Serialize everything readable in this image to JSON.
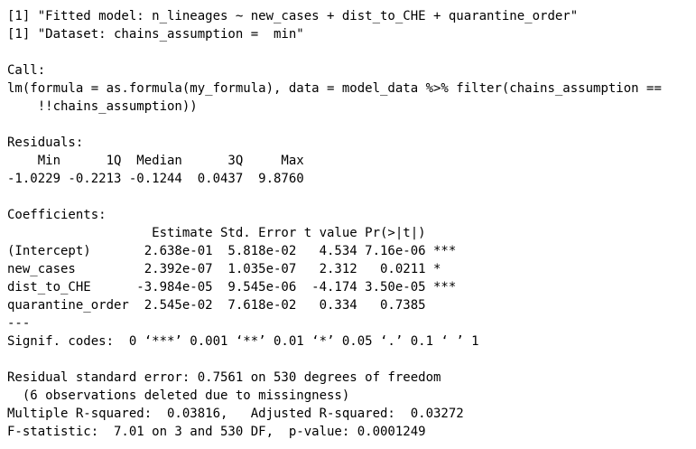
{
  "console": {
    "lines": [
      "[1] \"Fitted model: n_lineages ~ new_cases + dist_to_CHE + quarantine_order\"",
      "[1] \"Dataset: chains_assumption =  min\"",
      "",
      "Call:",
      "lm(formula = as.formula(my_formula), data = model_data %>% filter(chains_assumption ==",
      "    !!chains_assumption))",
      "",
      "Residuals:",
      "    Min      1Q  Median      3Q     Max ",
      "-1.0229 -0.2213 -0.1244  0.0437  9.8760 ",
      "",
      "Coefficients:",
      "                   Estimate Std. Error t value Pr(>|t|)    ",
      "(Intercept)       2.638e-01  5.818e-02   4.534 7.16e-06 ***",
      "new_cases         2.392e-07  1.035e-07   2.312   0.0211 *  ",
      "dist_to_CHE      -3.984e-05  9.545e-06  -4.174 3.50e-05 ***",
      "quarantine_order  2.545e-02  7.618e-02   0.334   0.7385    ",
      "---",
      "Signif. codes:  0 ‘***’ 0.001 ‘**’ 0.01 ‘*’ 0.05 ‘.’ 0.1 ‘ ’ 1",
      "",
      "Residual standard error: 0.7561 on 530 degrees of freedom",
      "  (6 observations deleted due to missingness)",
      "Multiple R-squared:  0.03816,\tAdjusted R-squared:  0.03272 ",
      "F-statistic:  7.01 on 3 and 530 DF,  p-value: 0.0001249"
    ]
  }
}
